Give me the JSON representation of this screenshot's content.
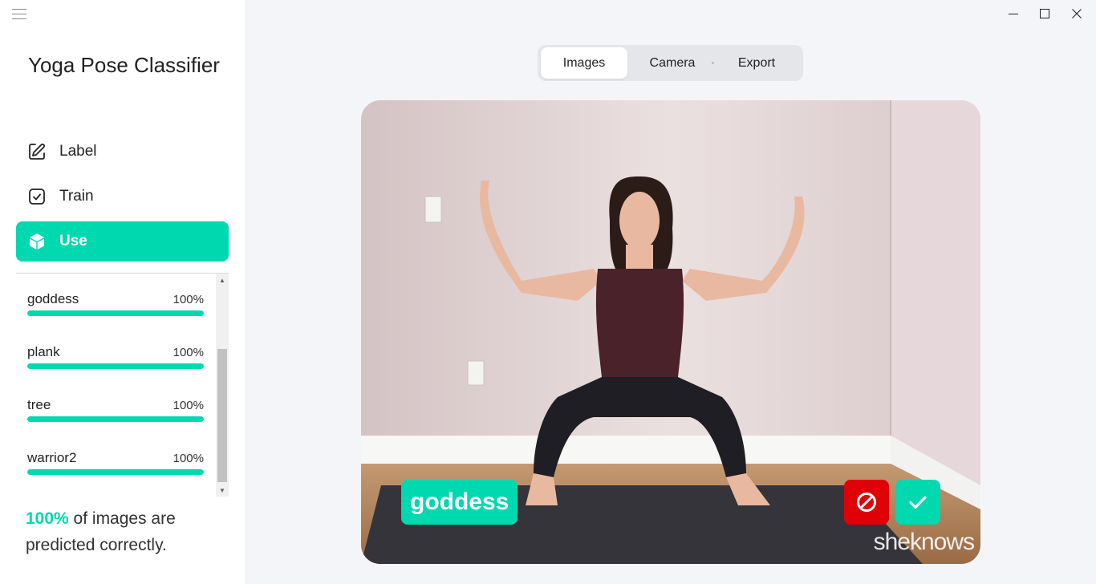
{
  "app": {
    "title": "Yoga Pose Classifier"
  },
  "nav": {
    "items": [
      {
        "label": "Label",
        "icon": "edit-icon",
        "active": false
      },
      {
        "label": "Train",
        "icon": "checkbox-icon",
        "active": false
      },
      {
        "label": "Use",
        "icon": "cube-icon",
        "active": true
      }
    ]
  },
  "results": [
    {
      "name": "goddess",
      "percent_text": "100%",
      "value": 1.0
    },
    {
      "name": "plank",
      "percent_text": "100%",
      "value": 1.0
    },
    {
      "name": "tree",
      "percent_text": "100%",
      "value": 1.0
    },
    {
      "name": "warrior2",
      "percent_text": "100%",
      "value": 1.0
    }
  ],
  "summary": {
    "highlight": "100%",
    "text": " of images are predicted correctly."
  },
  "tabs": [
    {
      "label": "Images",
      "active": true
    },
    {
      "label": "Camera",
      "active": false
    },
    {
      "label": "Export",
      "active": false
    }
  ],
  "preview": {
    "predicted_label": "goddess",
    "watermark": "sheknows"
  },
  "colors": {
    "accent": "#00d8b0",
    "reject": "#e00007"
  }
}
